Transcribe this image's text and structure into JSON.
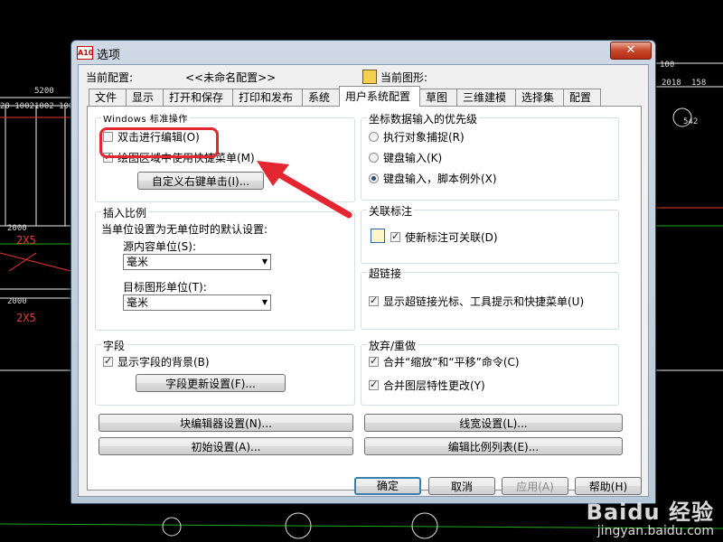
{
  "background": {
    "dims_left": [
      "5200",
      "20 1002",
      "1002 1002",
      "2000",
      "2X5",
      "2000",
      "2X5"
    ],
    "dims_right": [
      "100",
      "2018",
      "158",
      "542"
    ]
  },
  "dialog": {
    "title": "选项",
    "app_badge": "A10",
    "close_glyph": "✕",
    "current_profile_label": "当前配置:",
    "current_profile_value": "<<未命名配置>>",
    "current_drawing_label": "当前图形:",
    "current_drawing_value": "",
    "tabs": [
      {
        "label": "文件"
      },
      {
        "label": "显示"
      },
      {
        "label": "打开和保存"
      },
      {
        "label": "打印和发布"
      },
      {
        "label": "系统"
      },
      {
        "label": "用户系统配置"
      },
      {
        "label": "草图"
      },
      {
        "label": "三维建模"
      },
      {
        "label": "选择集"
      },
      {
        "label": "配置"
      }
    ],
    "active_tab": "用户系统配置",
    "windows_ops": {
      "title": "Windows 标准操作",
      "dblclick_edit": {
        "label": "双击进行编辑(O)",
        "checked": false
      },
      "shortcut_menu": {
        "label": "绘图区域中使用快捷菜单(M)",
        "checked": true
      },
      "custom_right_click": "自定义右键单击(I)..."
    },
    "insert_scale": {
      "title": "插入比例",
      "desc": "当单位设置为无单位时的默认设置:",
      "source_label": "源内容单位(S):",
      "source_value": "毫米",
      "target_label": "目标图形单位(T):",
      "target_value": "毫米"
    },
    "fields": {
      "title": "字段",
      "show_bg": {
        "label": "显示字段的背景(B)",
        "checked": true
      },
      "update_settings": "字段更新设置(F)..."
    },
    "coord_priority": {
      "title": "坐标数据输入的优先级",
      "options": [
        {
          "label": "执行对象捕捉(R)",
          "selected": false
        },
        {
          "label": "键盘输入(K)",
          "selected": false
        },
        {
          "label": "键盘输入，脚本例外(X)",
          "selected": true
        }
      ]
    },
    "assoc_dim": {
      "title": "关联标注",
      "new_assoc": {
        "label": "使新标注可关联(D)",
        "checked": true
      }
    },
    "hyperlink": {
      "title": "超链接",
      "show_cursor": {
        "label": "显示超链接光标、工具提示和快捷菜单(U)",
        "checked": true
      }
    },
    "undo_redo": {
      "title": "放弃/重做",
      "merge_zoom_pan": {
        "label": "合并“缩放”和“平移”命令(C)",
        "checked": true
      },
      "merge_layer": {
        "label": "合并图层特性更改(Y)",
        "checked": true
      }
    },
    "buttons": {
      "block_editor": "块编辑器设置(N)...",
      "lineweight": "线宽设置(L)...",
      "initial_setup": "初始设置(A)...",
      "edit_scale_list": "编辑比例列表(E)...",
      "ok": "确定",
      "cancel": "取消",
      "apply": "应用(A)",
      "help": "帮助(H)"
    }
  },
  "watermark": {
    "logo": "Baidu 经验",
    "url": "jingyan.baidu.com"
  },
  "annotation": {
    "highlight_color": "#e3262f",
    "arrow_color": "#e3262f"
  },
  "colors": {
    "cad_background": "#000000",
    "dialog_frame": "#cfd9e5",
    "close_button": "#c7462b",
    "default_button_border": "#3c7fb1"
  }
}
